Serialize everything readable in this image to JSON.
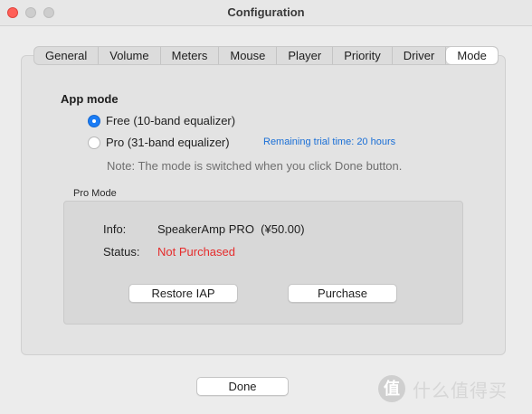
{
  "window": {
    "title": "Configuration"
  },
  "tabs": [
    {
      "label": "General"
    },
    {
      "label": "Volume"
    },
    {
      "label": "Meters"
    },
    {
      "label": "Mouse"
    },
    {
      "label": "Player"
    },
    {
      "label": "Priority"
    },
    {
      "label": "Driver"
    },
    {
      "label": "Mode",
      "active": true
    }
  ],
  "app_mode": {
    "heading": "App mode",
    "options": [
      {
        "label": "Free (10-band equalizer)",
        "selected": true
      },
      {
        "label": "Pro (31-band equalizer)",
        "selected": false
      }
    ],
    "trial_text": "Remaining trial time: 20 hours",
    "note": "Note: The mode is switched when you click Done button."
  },
  "pro_mode": {
    "group_label": "Pro Mode",
    "info_label": "Info:",
    "info_value": "SpeakerAmp PRO  (¥50.00)",
    "status_label": "Status:",
    "status_value": "Not Purchased",
    "status_color": "#e52c2c",
    "restore_label": "Restore IAP",
    "purchase_label": "Purchase"
  },
  "footer": {
    "done_label": "Done"
  },
  "watermark": {
    "icon_glyph": "值",
    "text": "什么值得买"
  }
}
